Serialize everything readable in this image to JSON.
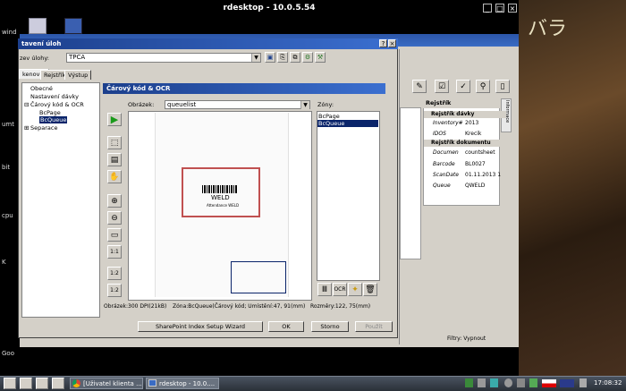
{
  "rdesktop": {
    "title": "rdesktop - 10.0.5.54",
    "min": "_",
    "max": "□",
    "close": "×"
  },
  "desktop": {
    "labels": [
      "wind",
      "umt",
      "bit",
      "cpu",
      "K",
      "Goo"
    ],
    "jp_text": "バラ"
  },
  "dialog": {
    "title": "tavení úloh",
    "help": "?",
    "close": "×",
    "task_label": "zev úlohy:",
    "task_value": "TPCA",
    "tabs": [
      "kenovat",
      "Rejstřík",
      "Výstup"
    ],
    "tree": [
      "Obecné",
      "Nastavení dávky",
      "Čárový kód & OCR",
      "BcPage",
      "BcQueue",
      "Separace"
    ],
    "panel_title": "Čárový kód & OCR",
    "image_label": "Obrázek:",
    "image_value": "queuelist",
    "zones_label": "Zóny:",
    "zones": [
      "BcPage",
      "BcQueue"
    ],
    "preview_text": "WELD",
    "preview_small": "Attendance WELD",
    "zoom_labels": [
      "1:1",
      "1:2",
      "1:2"
    ],
    "status_image": "Obrázek:300 DPI(21kB)",
    "status_zone": "Zóna:BcQueue(Čárový kód; Umístění:47, 91(mm)",
    "status_size": "Rozměry:122, 75(mm)",
    "ocr_label": "OCR",
    "buttons": {
      "wizard": "SharePoint Index Setup Wizard",
      "ok": "OK",
      "cancel": "Storno",
      "apply": "Použít"
    }
  },
  "right_pane": {
    "title": "Rejstřík",
    "side_tab": "Informace",
    "sections": [
      {
        "name": "Rejstřík dávky",
        "rows": [
          {
            "k": "Inventory#",
            "v": "2013"
          },
          {
            "k": "IDOS",
            "v": "Krecik"
          }
        ]
      },
      {
        "name": "Rejstřík dokumentu",
        "rows": [
          {
            "k": "Documen",
            "v": "countsheet"
          },
          {
            "k": "Barcode",
            "v": "BL0027"
          },
          {
            "k": "ScanDate",
            "v": "01.11.2013 1"
          },
          {
            "k": "Queue",
            "v": "QWELD"
          }
        ]
      }
    ],
    "filter": "Filtry: Vypnout"
  },
  "taskbar": {
    "tasks": [
      "[Uživatel klienta ...",
      "rdesktop - 10.0...."
    ],
    "clock": "17:08:32"
  },
  "colors": {
    "titlebar": "#1c3f8c",
    "dialog": "#d4d0c8",
    "zone_sel": "#0a246a",
    "mark_red": "#c0392b"
  }
}
